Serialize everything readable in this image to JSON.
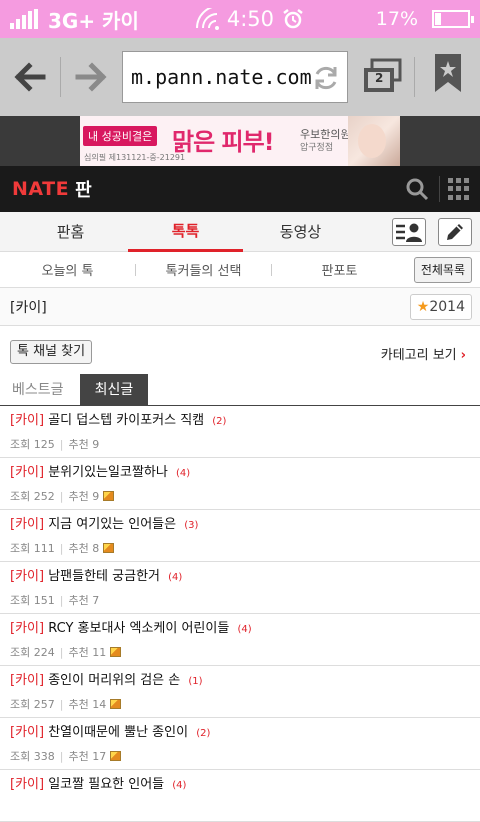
{
  "status": {
    "network": "3G+ 카이",
    "time": "4:50",
    "battery": "17%",
    "battery_level": 0.17
  },
  "browser": {
    "url": "m.pann.nate.com",
    "tab_count": "2"
  },
  "ad": {
    "tag": "내 성공비결은",
    "headline": "맑은 피부!",
    "clinic": "우보한의원",
    "location": "압구정점",
    "code": "심의필 제131121-중-21291"
  },
  "header": {
    "logo": "NATE",
    "section": "판"
  },
  "main_tabs": [
    "판홈",
    "톡톡",
    "동영상"
  ],
  "sub_tabs": [
    "오늘의 톡",
    "톡커들의 선택",
    "판포토"
  ],
  "all_list_label": "전체목록",
  "topic": "[카이]",
  "year_badge": "2014",
  "channel_button": "톡 채널 찾기",
  "category_link": "카테고리 보기",
  "list_tabs": {
    "best": "베스트글",
    "newest": "최신글"
  },
  "meta_labels": {
    "views": "조회",
    "recommend": "추천"
  },
  "posts": [
    {
      "tag": "[카이]",
      "title": "골디 덥스텝 카이포커스 직캠",
      "comments": "(2)",
      "views": "125",
      "recs": "9",
      "has_image": false
    },
    {
      "tag": "[카이]",
      "title": "분위기있는일코짤하나",
      "comments": "(4)",
      "views": "252",
      "recs": "9",
      "has_image": true
    },
    {
      "tag": "[카이]",
      "title": "지금 여기있는 인어들은",
      "comments": "(3)",
      "views": "111",
      "recs": "8",
      "has_image": true
    },
    {
      "tag": "[카이]",
      "title": "남팬들한테 궁금한거",
      "comments": "(4)",
      "views": "151",
      "recs": "7",
      "has_image": false
    },
    {
      "tag": "[카이]",
      "title": "RCY 홍보대사 엑소케이 어린이들",
      "comments": "(4)",
      "views": "224",
      "recs": "11",
      "has_image": true
    },
    {
      "tag": "[카이]",
      "title": "종인이 머리위의 검은 손",
      "comments": "(1)",
      "views": "257",
      "recs": "14",
      "has_image": true
    },
    {
      "tag": "[카이]",
      "title": "찬열이때문에 뿔난 종인이",
      "comments": "(2)",
      "views": "338",
      "recs": "17",
      "has_image": true
    },
    {
      "tag": "[카이]",
      "title": "일코짤 필요한 인어들",
      "comments": "(4)",
      "views": "",
      "recs": "",
      "has_image": false
    }
  ]
}
